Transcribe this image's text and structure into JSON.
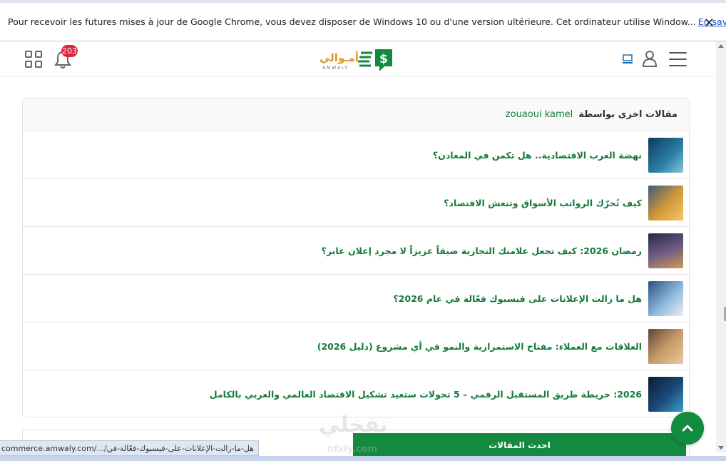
{
  "infobar": {
    "message": "Pour recevoir les futures mises à jour de Google Chrome, vous devez disposer de Windows 10 ou d'une version ultérieure. Cet ordinateur utilise Window...",
    "link": "En savoir plus",
    "close": "✕"
  },
  "header": {
    "notification_count": "203",
    "logo_text": "أمـوالي",
    "logo_subtext": "AMWALY"
  },
  "author_box": {
    "heading": "مقالات اخرى بواسطة",
    "author": "zouaoui kamel",
    "articles": [
      {
        "title": "نهضة العرب الاقتصادية.. هل تكمن في المعادن؟",
        "thumb_color": "#1e5a7a"
      },
      {
        "title": "كيف تُحرّك الرواتب الأسواق وتنعش الاقتصاد؟",
        "thumb_color": "#b8862c"
      },
      {
        "title": "رمضان 2026: كيف تجعل علامتك التجارية ضيفاً عزيزاً لا مجرد إعلان عابر؟",
        "thumb_color": "#5a4a6e"
      },
      {
        "title": "هل ما زالت الإعلانات على فيسبوك فعّالة في عام 2026؟",
        "thumb_color": "#3b6e9e"
      },
      {
        "title": "العلاقات مع العملاء: مفتاح الاستمرارية والنمو في أي مشروع (دليل 2026)",
        "thumb_color": "#7a5a3a"
      },
      {
        "title": "2026: خريطة طريق المستقبل الرقمي – 5 تحولات ستعيد تشكيل الاقتصاد العالمي والعربي بالكامل",
        "thumb_color": "#12304e"
      }
    ]
  },
  "latest_button": "احدث المقالات",
  "status_url": "commerce.amwaly.com/.../هل-ما-زالت-الإعلانات-على-فيسبوك-فعّالة-في",
  "watermark": {
    "text": "نفخلي",
    "sub": "nfxly.com"
  },
  "colors": {
    "accent": "#138a3f",
    "link": "#157a3d",
    "badge": "#e0243a"
  }
}
